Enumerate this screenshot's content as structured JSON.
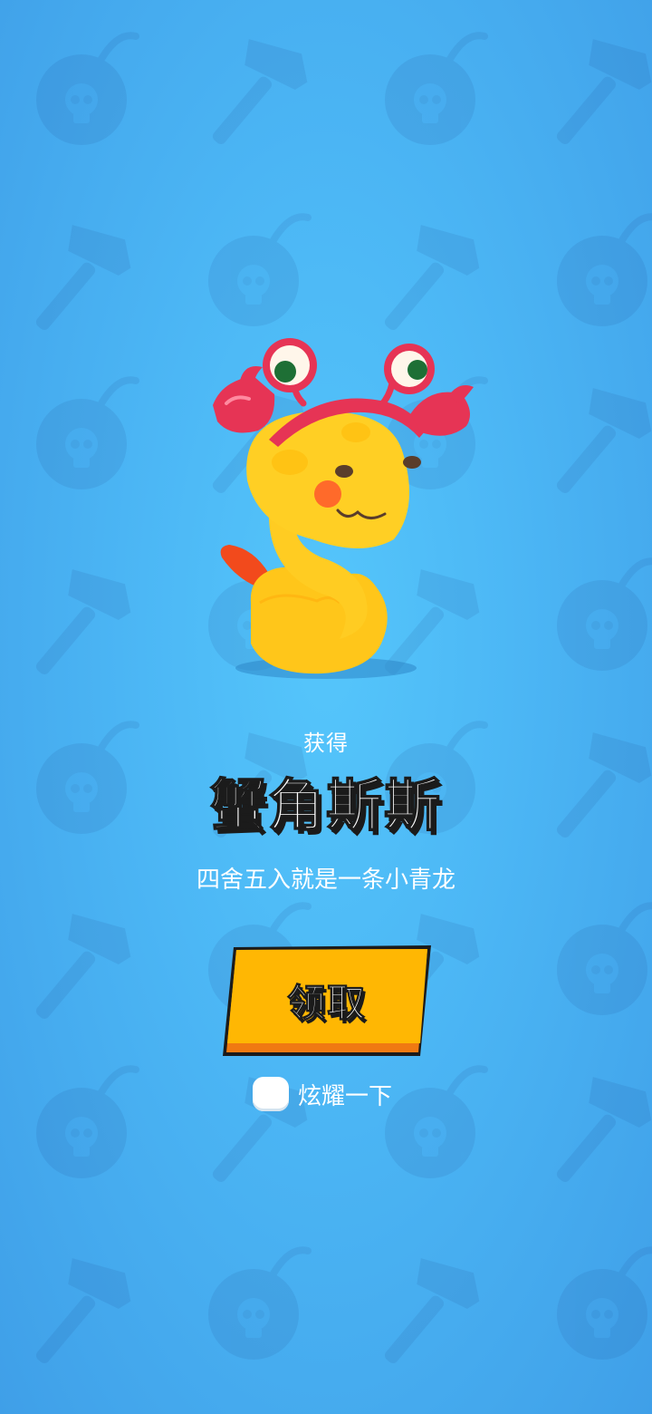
{
  "reward": {
    "obtained_label": "获得",
    "item_name": "蟹角斯斯",
    "item_description": "四舍五入就是一条小青龙"
  },
  "actions": {
    "claim_label": "领取",
    "showoff_label": "炫耀一下",
    "showoff_checked": false
  },
  "icons": {
    "background_pattern": [
      "bomb-skull-icon",
      "hammer-icon"
    ],
    "character": "yellow-snake-with-crab-hat"
  },
  "colors": {
    "background_top": "#3f9fe8",
    "background_center": "#55c6fb",
    "button_fill": "#ffb703",
    "button_shadow": "#f07a12",
    "outline": "#1b1b1b",
    "text": "#ffffff"
  }
}
